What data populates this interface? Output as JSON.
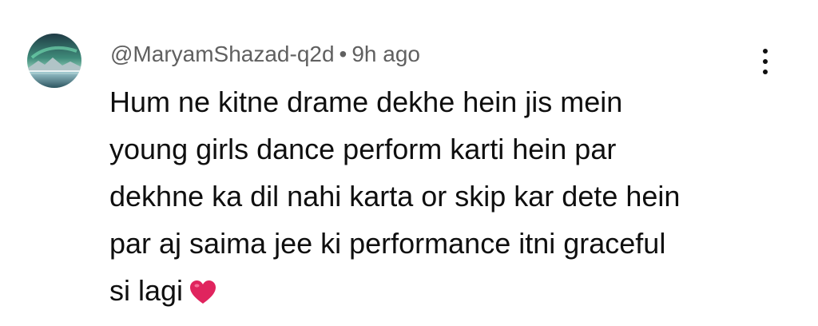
{
  "comment": {
    "author": "@MaryamShazad-q2d",
    "separator": "•",
    "timestamp": "9h ago",
    "text_lines": [
      "Hum ne kitne drame dekhe hein jis mein",
      "young girls dance perform karti hein par",
      "dekhne ka dil nahi karta or skip kar dete hein",
      "par aj saima jee ki performance itni graceful",
      "si lagi"
    ],
    "emoji": "heart-emoji",
    "avatar_icon": "aurora-landscape-avatar",
    "menu_icon": "more-vertical-icon"
  },
  "colors": {
    "meta_text": "#606060",
    "body_text": "#0f0f0f",
    "heart": "#e0245e"
  }
}
